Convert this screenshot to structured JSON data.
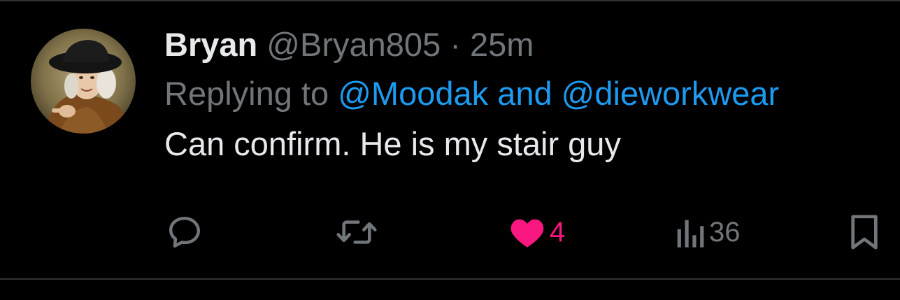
{
  "tweet": {
    "author": {
      "display_name": "Bryan",
      "handle": "@Bryan805",
      "separator": "·",
      "time": "25m"
    },
    "reply": {
      "prefix": "Replying to",
      "mention_1": "@Moodak",
      "conjunction": "and",
      "mention_2": "@dieworkwear"
    },
    "text": "Can confirm. He is my stair guy",
    "actions": {
      "reply_icon": "speech-bubble-icon",
      "retweet_icon": "retweet-icon",
      "like_icon": "heart-icon",
      "like_count": "4",
      "views_icon": "bar-chart-icon",
      "views_count": "36",
      "bookmark_icon": "bookmark-icon"
    }
  },
  "colors": {
    "background": "#000000",
    "primary_text": "#e7e9ea",
    "secondary_text": "#71767b",
    "link": "#1d9bf0",
    "like": "#f91880",
    "divider": "#2f3336"
  }
}
